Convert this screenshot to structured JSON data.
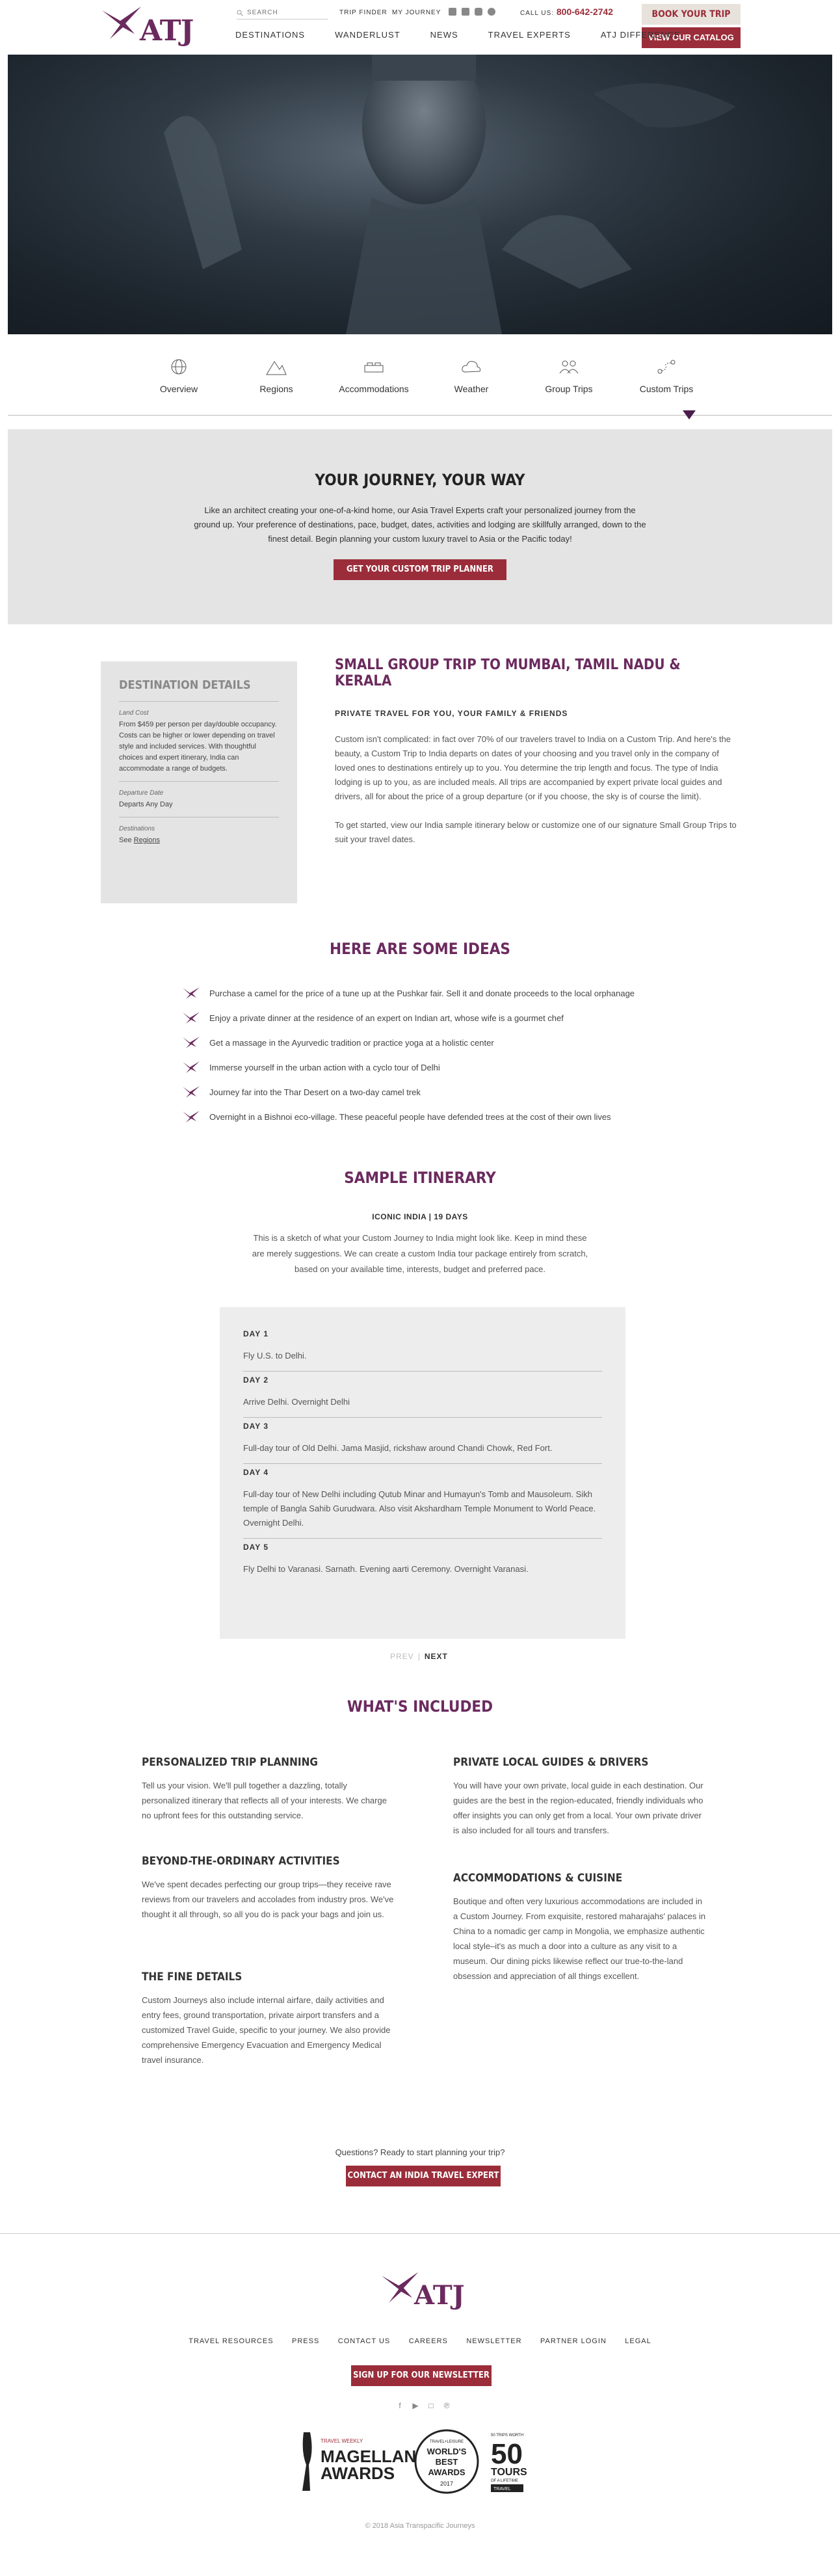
{
  "header": {
    "search_placeholder": "SEARCH",
    "trip_finder": "TRIP FINDER",
    "my_journey": "MY JOURNEY",
    "call_label": "CALL US:",
    "phone": "800-642-2742",
    "book_btn": "BOOK YOUR TRIP",
    "catalog_btn": "VIEW OUR CATALOG",
    "logo_text": "ATJ",
    "nav": [
      "DESTINATIONS",
      "WANDERLUST",
      "NEWS",
      "TRAVEL EXPERTS",
      "ATJ DIFFERENCE"
    ]
  },
  "tabs": [
    {
      "label": "Overview",
      "icon": "globe-icon"
    },
    {
      "label": "Regions",
      "icon": "mountain-icon"
    },
    {
      "label": "Accommodations",
      "icon": "bed-icon"
    },
    {
      "label": "Weather",
      "icon": "cloud-icon"
    },
    {
      "label": "Group Trips",
      "icon": "group-icon"
    },
    {
      "label": "Custom Trips",
      "icon": "custom-route-icon"
    }
  ],
  "journey": {
    "title": "YOUR JOURNEY, YOUR WAY",
    "text": "Like an architect creating your one-of-a-kind home, our Asia Travel Experts craft your personalized journey from the ground up. Your preference of destinations, pace, budget, dates, activities and lodging are skillfully arranged, down to the finest detail. Begin planning your custom luxury travel to Asia or the Pacific today!",
    "button": "GET YOUR CUSTOM TRIP PLANNER"
  },
  "details": {
    "title": "DESTINATION DETAILS",
    "land_cost_label": "Land Cost",
    "land_cost": "From $459 per person per day/double occupancy. Costs can be higher or lower depending on travel style and included services. With thoughtful choices and expert itinerary, India can accommodate a range of budgets.",
    "departure_label": "Departure Date",
    "departure": "Departs Any Day",
    "destinations_label": "Destinations",
    "see_prefix": "See ",
    "regions_link": "Regions"
  },
  "main": {
    "title": "SMALL GROUP TRIP TO MUMBAI, TAMIL NADU & KERALA",
    "subtitle": "PRIVATE TRAVEL FOR YOU, YOUR FAMILY & FRIENDS",
    "p1": "Custom isn't complicated: in fact over 70% of our travelers travel to India on a Custom Trip. And here's the beauty, a Custom Trip to India departs on dates of your choosing and you travel only in the company of loved ones to destinations entirely up to you. You determine the trip length and focus. The type of India lodging is up to you, as are included meals. All trips are accompanied by expert private local guides and drivers, all for about the price of a group departure (or if you choose, the sky is of course the limit).",
    "p2": "To get started, view our India sample itinerary below or customize one of our signature Small Group Trips to suit your travel dates."
  },
  "ideas": {
    "title": "HERE ARE SOME IDEAS",
    "items": [
      "Purchase a camel for the price of a tune up at the Pushkar fair. Sell it and donate proceeds to the local orphanage",
      "Enjoy a private dinner at the residence of an expert on Indian art, whose wife is a gourmet chef",
      "Get a massage in the Ayurvedic tradition or practice yoga at a holistic center",
      "Immerse yourself in the urban action with a cyclo tour of Delhi",
      "Journey far into the Thar Desert on a two-day camel trek",
      "Overnight in a Bishnoi eco-village. These peaceful people have defended trees at the cost of their own lives"
    ]
  },
  "itinerary": {
    "title": "SAMPLE ITINERARY",
    "name": "ICONIC INDIA",
    "sep": " | ",
    "days_count": "19 DAYS",
    "intro": "This is a sketch of what your Custom Journey to India might look like. Keep in mind these are merely suggestions. We can create a custom India tour package entirely from scratch, based on your available time, interests, budget and preferred pace.",
    "days": [
      {
        "label": "DAY 1",
        "text": "Fly U.S. to Delhi."
      },
      {
        "label": "DAY 2",
        "text": "Arrive Delhi. Overnight Delhi"
      },
      {
        "label": "DAY 3",
        "text": "Full-day tour of Old Delhi. Jama Masjid, rickshaw around Chandi Chowk, Red Fort."
      },
      {
        "label": "DAY 4",
        "text": "Full-day tour of New Delhi including Qutub Minar and Humayun's Tomb and Mausoleum. Sikh temple of Bangla Sahib Gurudwara. Also visit Akshardham Temple Monument to World Peace. Overnight Delhi."
      },
      {
        "label": "DAY 5",
        "text": "Fly Delhi to Varanasi. Sarnath. Evening aarti Ceremony. Overnight Varanasi."
      }
    ],
    "prev": "PREV",
    "pager_sep": "|",
    "next": "NEXT"
  },
  "included": {
    "title": "WHAT'S INCLUDED",
    "items": [
      {
        "heading": "PERSONALIZED TRIP PLANNING",
        "text": "Tell us your vision. We'll pull together a dazzling, totally personalized itinerary that reflects all of your interests. We charge no upfront fees for this outstanding service."
      },
      {
        "heading": "BEYOND-THE-ORDINARY ACTIVITIES",
        "text": "We've spent decades perfecting our group trips—they receive rave reviews from our travelers and accolades from industry pros. We've thought it all through, so all you do is pack your bags and join us."
      },
      {
        "heading": "THE FINE DETAILS",
        "text": "Custom Journeys also include internal airfare, daily activities and entry fees, ground transportation, private airport transfers and a customized Travel Guide, specific to your journey. We also provide comprehensive Emergency Evacuation and Emergency Medical travel insurance."
      },
      {
        "heading": "PRIVATE LOCAL GUIDES & DRIVERS",
        "text": "You will have your own private, local guide in each destination. Our guides are the best in the region-educated, friendly individuals who offer insights you can only get from a local. Your own private driver is also included for all tours and transfers."
      },
      {
        "heading": "ACCOMMODATIONS & CUISINE",
        "text": "Boutique and often very luxurious accommodations are included in a Custom Journey. From exquisite, restored maharajahs' palaces in China to a nomadic ger camp in Mongolia, we emphasize authentic local style–it's as much a door into a culture as any visit to a museum. Our dining picks likewise reflect our true-to-the-land obsession and appreciation of all things excellent."
      }
    ]
  },
  "cta": {
    "question": "Questions? Ready to start planning your trip?",
    "button": "CONTACT AN INDIA TRAVEL EXPERT"
  },
  "footer": {
    "logo_text": "ATJ",
    "links": [
      "TRAVEL RESOURCES",
      "PRESS",
      "CONTACT US",
      "CAREERS",
      "NEWSLETTER",
      "PARTNER LOGIN",
      "LEGAL"
    ],
    "newsletter_btn": "SIGN UP FOR OUR NEWSLETTER",
    "social_icons": [
      "facebook-icon",
      "youtube-icon",
      "instagram-icon",
      "pinterest-icon"
    ],
    "awards": {
      "magellan_top": "TRAVEL WEEKLY",
      "magellan_1": "MAGELLAN",
      "magellan_2": "AWARDS",
      "wb_top": "TRAVEL+LEISURE",
      "wb_1": "WORLD'S",
      "wb_2": "BEST",
      "wb_3": "AWARDS",
      "wb_year": "2017",
      "tours_top": "50 TRIPS WORTH",
      "tours_num": "50",
      "tours_word": "TOURS",
      "tours_sub": "OF A LIFETIME",
      "tours_brand": "TRAVEL"
    },
    "copyright": "© 2018 Asia Transpacific Journeys"
  },
  "colors": {
    "brand": "#6b2a5e",
    "accent": "#9b2d3a"
  }
}
